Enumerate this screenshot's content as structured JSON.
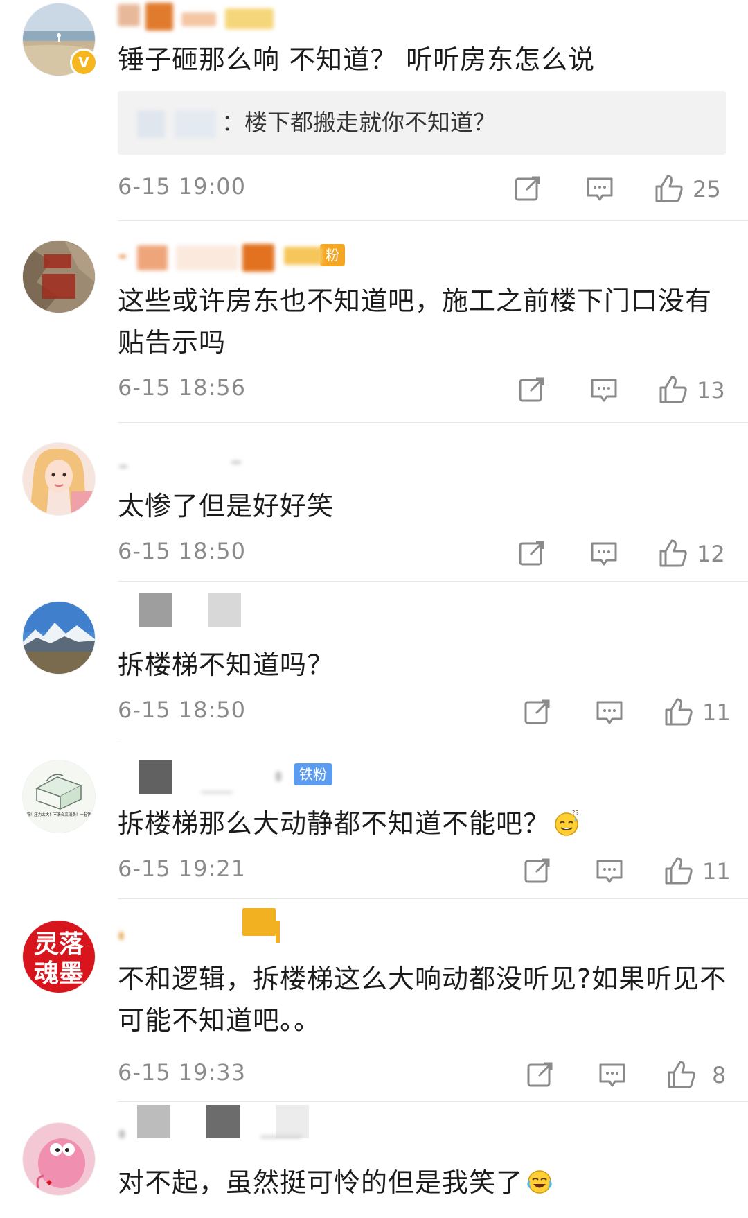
{
  "comments": [
    {
      "text": "锤子砸那么响 不知道？ 听听房东怎么说",
      "quote": {
        "author_suffix": "：",
        "text": "楼下都搬走就你不知道？"
      },
      "time": "6-15 19:00",
      "likes": "25",
      "verified": true,
      "avatar": "beach-photo"
    },
    {
      "text": "这些或许房东也不知道吧，施工之前楼下门口没有贴告示吗",
      "badge": "粉",
      "time": "6-15 18:56",
      "likes": "13",
      "avatar": "stone-carving"
    },
    {
      "text": "太惨了但是好好笑",
      "time": "6-15 18:50",
      "likes": "12",
      "avatar": "girl-portrait"
    },
    {
      "text": "拆楼梯不知道吗？",
      "time": "6-15 18:50",
      "likes": "11",
      "avatar": "snow-mountain"
    },
    {
      "text": "拆楼梯那么大动静都不知道不能吧？",
      "badge": "铁粉",
      "emoji": "confused-sweat-emoji",
      "time": "6-15 19:21",
      "likes": "11",
      "avatar": "cartoon-sketch"
    },
    {
      "text": "不和逻辑，拆楼梯这么大响动都没听见?如果听见不可能不知道吧。。",
      "time": "6-15 19:33",
      "likes": "8",
      "avatar": "red-calligraphy"
    },
    {
      "text": "对不起，虽然挺可怜的但是我笑了",
      "emoji": "crying-laugh-emoji",
      "avatar": "pink-cartoon"
    }
  ],
  "avatar_text": {
    "red-calligraphy": [
      "灵落",
      "魂墨"
    ],
    "cartoon-sketch": "你收入太低！压力太大！不滴合高消费！一起钱就上火！"
  },
  "colors": {
    "text": "#1b1b1b",
    "meta": "#8a8a8a",
    "quote_bg": "#f2f2f2",
    "divider": "#e6e6e6",
    "fan_badge_orange": "#f5a623",
    "fan_badge_blue": "#5b9bf0",
    "verified": "#f6b620"
  },
  "icons": {
    "repost": "repost-icon",
    "comment": "comment-icon",
    "like": "like-thumb-icon"
  }
}
